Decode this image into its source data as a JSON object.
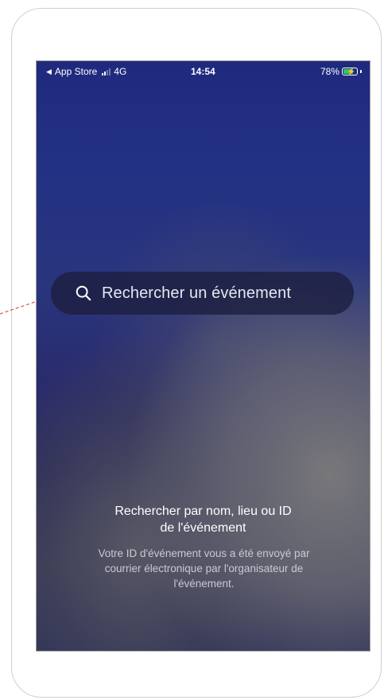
{
  "status_bar": {
    "back_label": "App Store",
    "network": "4G",
    "time": "14:54",
    "battery_percent": "78%",
    "battery_level": 0.78,
    "battery_charging": true,
    "icons": [
      "back-triangle-icon",
      "signal-icon",
      "battery-icon",
      "charging-bolt-icon"
    ]
  },
  "search": {
    "placeholder": "Rechercher un événement",
    "icon": "search-icon"
  },
  "info": {
    "title_line1": "Rechercher par nom, lieu ou ID",
    "title_line2": "de l'événement",
    "body_line1": "Votre ID d'événement vous a été envoyé par",
    "body_line2": "courrier électronique par l'organisateur de",
    "body_line3": "l'événement."
  },
  "colors": {
    "callout": "#d32f2f",
    "charging": "#35c759"
  }
}
